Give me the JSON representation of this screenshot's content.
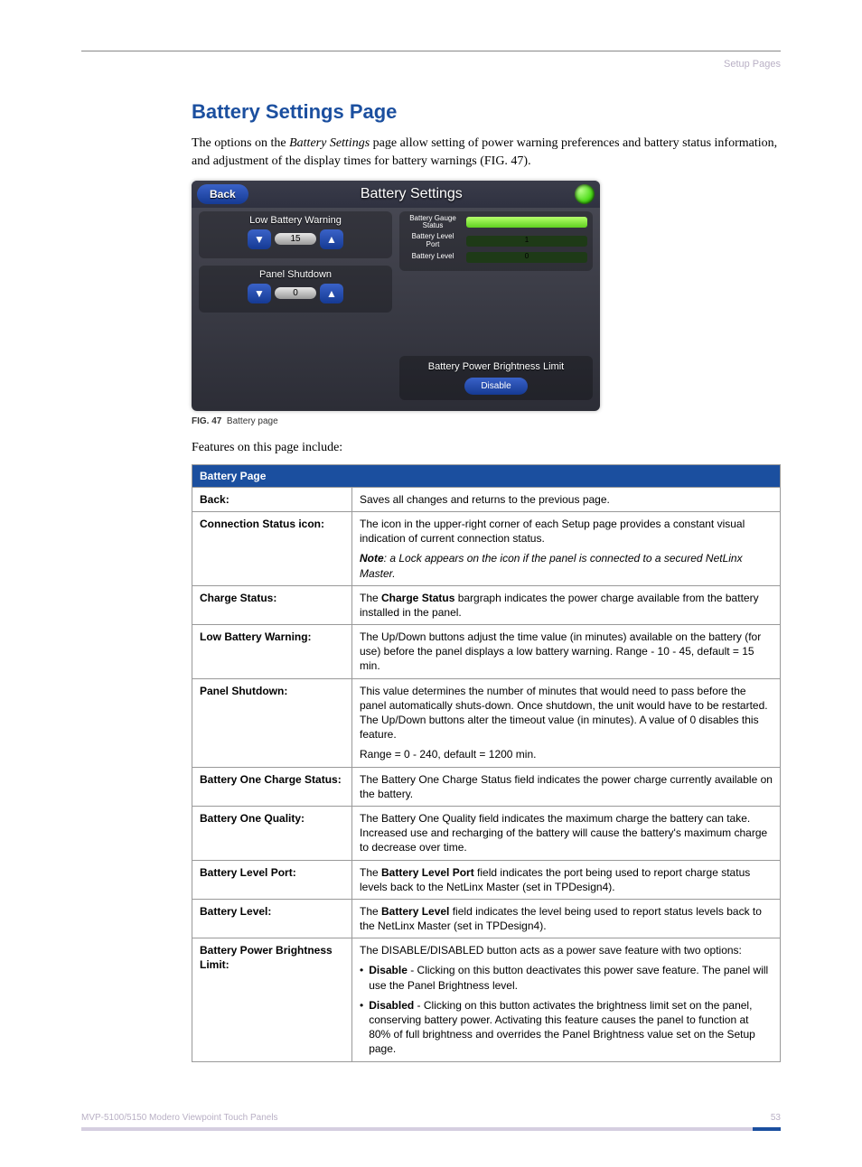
{
  "header": {
    "section": "Setup Pages"
  },
  "title": "Battery Settings Page",
  "intro": {
    "prefix": "The options on the ",
    "em": "Battery Settings",
    "suffix": " page allow setting of power warning preferences and battery status information, and adjustment of the display times for battery warnings (FIG. 47)."
  },
  "panel": {
    "back": "Back",
    "title": "Battery Settings",
    "low_battery": {
      "label": "Low Battery Warning",
      "value": "15"
    },
    "shutdown": {
      "label": "Panel Shutdown",
      "value": "0"
    },
    "gauge_lbl": "Battery Gauge Status",
    "port_lbl": "Battery Level Port",
    "port_val": "1",
    "level_lbl": "Battery Level",
    "level_val": "0",
    "bpl_title": "Battery Power Brightness Limit",
    "bpl_btn": "Disable"
  },
  "fig": {
    "num": "FIG. 47",
    "cap": "Battery page"
  },
  "features_line": "Features on this page include:",
  "table": {
    "header": "Battery Page",
    "rows": [
      {
        "label": "Back:",
        "paras": [
          "Saves all changes and returns to the previous page."
        ]
      },
      {
        "label": "Connection Status icon:",
        "paras": [
          "The icon in the upper-right corner of each Setup page provides a constant visual indication of current connection status.",
          {
            "note_b": "Note",
            "note_i": ": a Lock appears on the icon if the panel is connected to a secured NetLinx Master."
          }
        ]
      },
      {
        "label": "Charge Status:",
        "paras": [
          {
            "mix": [
              {
                "t": "plain",
                "v": "The "
              },
              {
                "t": "b",
                "v": "Charge Status"
              },
              {
                "t": "plain",
                "v": " bargraph indicates the power charge available from the battery installed in the panel."
              }
            ]
          }
        ]
      },
      {
        "label": "Low Battery Warning:",
        "paras": [
          "The Up/Down buttons adjust the time value (in minutes) available on the battery (for use) before the panel displays a low battery warning. Range - 10 - 45, default = 15 min."
        ]
      },
      {
        "label": "Panel Shutdown:",
        "paras": [
          "This value determines the number of minutes that would need to pass before the panel automatically shuts-down. Once shutdown, the unit would have to be restarted. The Up/Down buttons alter the timeout value (in minutes). A value of 0 disables this feature.",
          "Range = 0 - 240, default = 1200 min."
        ]
      },
      {
        "label": "Battery One Charge Status:",
        "paras": [
          "The Battery One Charge Status field indicates the power charge currently available on the battery."
        ]
      },
      {
        "label": "Battery One Quality:",
        "paras": [
          "The Battery One Quality field indicates the maximum charge the battery can take. Increased use and recharging of the battery will cause the battery's maximum charge to decrease over time."
        ]
      },
      {
        "label": "Battery Level Port:",
        "paras": [
          {
            "mix": [
              {
                "t": "plain",
                "v": "The "
              },
              {
                "t": "b",
                "v": "Battery Level Port"
              },
              {
                "t": "plain",
                "v": " field indicates the port being used to report charge status levels back to the NetLinx Master (set in TPDesign4)."
              }
            ]
          }
        ]
      },
      {
        "label": "Battery Level:",
        "paras": [
          {
            "mix": [
              {
                "t": "plain",
                "v": "The "
              },
              {
                "t": "b",
                "v": "Battery Level"
              },
              {
                "t": "plain",
                "v": " field indicates the level being used to report status levels back to the NetLinx Master (set in TPDesign4)."
              }
            ]
          }
        ]
      },
      {
        "label": "Battery Power Brightness Limit:",
        "paras": [
          "The DISABLE/DISABLED button acts as a power save feature with two options:",
          {
            "bullet_b": "Disable",
            "bullet_rest": " - Clicking on this button deactivates this power save feature. The panel will use the Panel Brightness level."
          },
          {
            "bullet_b": "Disabled",
            "bullet_rest": " - Clicking on this button activates the brightness limit set on the panel, conserving battery power. Activating this feature causes the panel to function at 80% of full brightness and overrides the Panel Brightness value set on the Setup page."
          }
        ]
      }
    ]
  },
  "footer": {
    "doc": "MVP-5100/5150 Modero Viewpoint  Touch Panels",
    "page": "53"
  }
}
